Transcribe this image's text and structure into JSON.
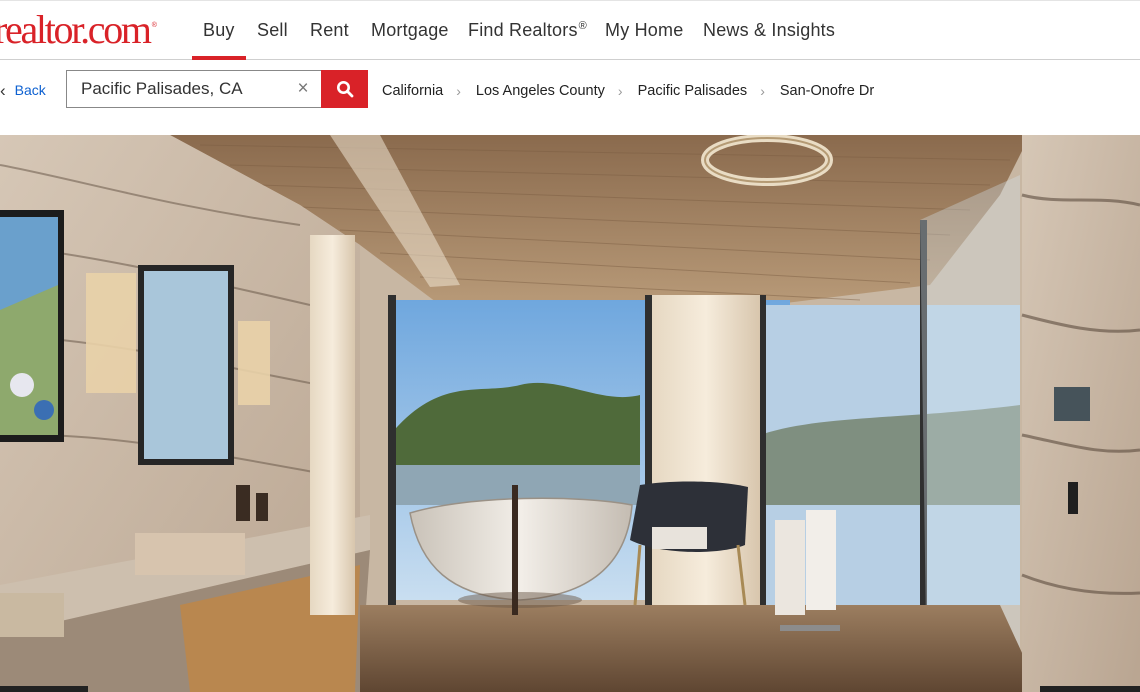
{
  "header": {
    "logo_text": "realtor.com",
    "logo_mark": "®",
    "brand_color": "#d92228",
    "nav": [
      {
        "label": "Buy",
        "active": true
      },
      {
        "label": "Sell"
      },
      {
        "label": "Rent"
      },
      {
        "label": "Mortgage"
      },
      {
        "label": "Find Realtors",
        "superscript": "®"
      },
      {
        "label": "My Home"
      },
      {
        "label": "News & Insights"
      }
    ]
  },
  "search": {
    "back_label": "Back",
    "query": "Pacific Palisades, CA",
    "clear_icon": "close-icon",
    "button_icon": "search-icon"
  },
  "breadcrumbs": [
    "California",
    "Los Angeles County",
    "Pacific Palisades",
    "San-Onofre Dr"
  ],
  "gallery": {
    "subject": "primary bathroom photo with freestanding tub, stone walls, wood ceiling and ocean-view glass doors"
  }
}
